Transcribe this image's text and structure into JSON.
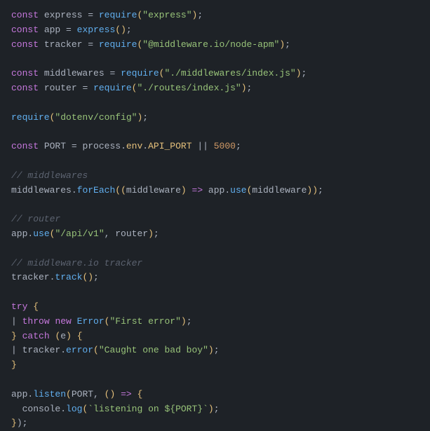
{
  "code": {
    "lines": [
      {
        "id": "l1",
        "tokens": [
          {
            "t": "kw",
            "v": "const"
          },
          {
            "t": "plain",
            "v": " express "
          },
          {
            "t": "op",
            "v": "="
          },
          {
            "t": "plain",
            "v": " "
          },
          {
            "t": "fn",
            "v": "require"
          },
          {
            "t": "paren",
            "v": "("
          },
          {
            "t": "str",
            "v": "\"express\""
          },
          {
            "t": "paren",
            "v": ")"
          },
          {
            "t": "plain",
            "v": ";"
          }
        ]
      },
      {
        "id": "l2",
        "tokens": [
          {
            "t": "kw",
            "v": "const"
          },
          {
            "t": "plain",
            "v": " app "
          },
          {
            "t": "op",
            "v": "="
          },
          {
            "t": "plain",
            "v": " "
          },
          {
            "t": "fn",
            "v": "express"
          },
          {
            "t": "paren",
            "v": "()"
          },
          {
            "t": "plain",
            "v": ";"
          }
        ]
      },
      {
        "id": "l3",
        "tokens": [
          {
            "t": "kw",
            "v": "const"
          },
          {
            "t": "plain",
            "v": " tracker "
          },
          {
            "t": "op",
            "v": "="
          },
          {
            "t": "plain",
            "v": " "
          },
          {
            "t": "fn",
            "v": "require"
          },
          {
            "t": "paren",
            "v": "("
          },
          {
            "t": "str",
            "v": "\"@middleware.io/node-apm\""
          },
          {
            "t": "paren",
            "v": ")"
          },
          {
            "t": "plain",
            "v": ";"
          }
        ]
      },
      {
        "id": "l4",
        "empty": true
      },
      {
        "id": "l5",
        "tokens": [
          {
            "t": "kw",
            "v": "const"
          },
          {
            "t": "plain",
            "v": " middlewares "
          },
          {
            "t": "op",
            "v": "="
          },
          {
            "t": "plain",
            "v": " "
          },
          {
            "t": "fn",
            "v": "require"
          },
          {
            "t": "paren",
            "v": "("
          },
          {
            "t": "str",
            "v": "\"./middlewares/index.js\""
          },
          {
            "t": "paren",
            "v": ")"
          },
          {
            "t": "plain",
            "v": ";"
          }
        ]
      },
      {
        "id": "l6",
        "tokens": [
          {
            "t": "kw",
            "v": "const"
          },
          {
            "t": "plain",
            "v": " router "
          },
          {
            "t": "op",
            "v": "="
          },
          {
            "t": "plain",
            "v": " "
          },
          {
            "t": "fn",
            "v": "require"
          },
          {
            "t": "paren",
            "v": "("
          },
          {
            "t": "str",
            "v": "\"./routes/index.js\""
          },
          {
            "t": "paren",
            "v": ")"
          },
          {
            "t": "plain",
            "v": ";"
          }
        ]
      },
      {
        "id": "l7",
        "empty": true
      },
      {
        "id": "l8",
        "tokens": [
          {
            "t": "fn",
            "v": "require"
          },
          {
            "t": "paren",
            "v": "("
          },
          {
            "t": "str",
            "v": "\"dotenv/config\""
          },
          {
            "t": "paren",
            "v": ")"
          },
          {
            "t": "plain",
            "v": ";"
          }
        ]
      },
      {
        "id": "l9",
        "empty": true
      },
      {
        "id": "l10",
        "tokens": [
          {
            "t": "kw",
            "v": "const"
          },
          {
            "t": "plain",
            "v": " PORT "
          },
          {
            "t": "op",
            "v": "="
          },
          {
            "t": "plain",
            "v": " process"
          },
          {
            "t": "plain",
            "v": "."
          },
          {
            "t": "prop",
            "v": "env"
          },
          {
            "t": "plain",
            "v": "."
          },
          {
            "t": "prop",
            "v": "API_PORT"
          },
          {
            "t": "plain",
            "v": " "
          },
          {
            "t": "op",
            "v": "||"
          },
          {
            "t": "plain",
            "v": " "
          },
          {
            "t": "num",
            "v": "5000"
          },
          {
            "t": "plain",
            "v": ";"
          }
        ]
      },
      {
        "id": "l11",
        "empty": true
      },
      {
        "id": "l12",
        "tokens": [
          {
            "t": "cm",
            "v": "// middlewares"
          }
        ]
      },
      {
        "id": "l13",
        "tokens": [
          {
            "t": "plain",
            "v": "middlewares"
          },
          {
            "t": "plain",
            "v": "."
          },
          {
            "t": "fn",
            "v": "forEach"
          },
          {
            "t": "paren",
            "v": "("
          },
          {
            "t": "paren",
            "v": "("
          },
          {
            "t": "plain",
            "v": "middleware"
          },
          {
            "t": "paren",
            "v": ")"
          },
          {
            "t": "plain",
            "v": " "
          },
          {
            "t": "arrow",
            "v": "=>"
          },
          {
            "t": "plain",
            "v": " app"
          },
          {
            "t": "plain",
            "v": "."
          },
          {
            "t": "fn",
            "v": "use"
          },
          {
            "t": "paren",
            "v": "("
          },
          {
            "t": "plain",
            "v": "middleware"
          },
          {
            "t": "paren",
            "v": "))"
          },
          {
            "t": "plain",
            "v": ";"
          }
        ]
      },
      {
        "id": "l14",
        "empty": true
      },
      {
        "id": "l15",
        "tokens": [
          {
            "t": "cm",
            "v": "// router"
          }
        ]
      },
      {
        "id": "l16",
        "tokens": [
          {
            "t": "plain",
            "v": "app"
          },
          {
            "t": "plain",
            "v": "."
          },
          {
            "t": "fn",
            "v": "use"
          },
          {
            "t": "paren",
            "v": "("
          },
          {
            "t": "str",
            "v": "\"/api/v1\""
          },
          {
            "t": "plain",
            "v": ", router"
          },
          {
            "t": "paren",
            "v": ")"
          },
          {
            "t": "plain",
            "v": ";"
          }
        ]
      },
      {
        "id": "l17",
        "empty": true
      },
      {
        "id": "l18",
        "tokens": [
          {
            "t": "cm",
            "v": "// middleware.io tracker"
          }
        ]
      },
      {
        "id": "l19",
        "tokens": [
          {
            "t": "plain",
            "v": "tracker"
          },
          {
            "t": "plain",
            "v": "."
          },
          {
            "t": "fn",
            "v": "track"
          },
          {
            "t": "paren",
            "v": "()"
          },
          {
            "t": "plain",
            "v": ";"
          }
        ]
      },
      {
        "id": "l20",
        "empty": true
      },
      {
        "id": "l21",
        "tokens": [
          {
            "t": "kw",
            "v": "try"
          },
          {
            "t": "plain",
            "v": " "
          },
          {
            "t": "paren",
            "v": "{"
          }
        ]
      },
      {
        "id": "l22",
        "tokens": [
          {
            "t": "plain",
            "v": "| "
          },
          {
            "t": "kw",
            "v": "throw"
          },
          {
            "t": "plain",
            "v": " "
          },
          {
            "t": "kw",
            "v": "new"
          },
          {
            "t": "plain",
            "v": " "
          },
          {
            "t": "fn",
            "v": "Error"
          },
          {
            "t": "paren",
            "v": "("
          },
          {
            "t": "str",
            "v": "\"First error\""
          },
          {
            "t": "paren",
            "v": ")"
          },
          {
            "t": "plain",
            "v": ";"
          }
        ]
      },
      {
        "id": "l23",
        "tokens": [
          {
            "t": "paren",
            "v": "}"
          },
          {
            "t": "plain",
            "v": " "
          },
          {
            "t": "kw",
            "v": "catch"
          },
          {
            "t": "plain",
            "v": " "
          },
          {
            "t": "paren",
            "v": "("
          },
          {
            "t": "plain",
            "v": "e"
          },
          {
            "t": "paren",
            "v": ")"
          },
          {
            "t": "plain",
            "v": " "
          },
          {
            "t": "paren",
            "v": "{"
          }
        ]
      },
      {
        "id": "l24",
        "tokens": [
          {
            "t": "plain",
            "v": "| "
          },
          {
            "t": "plain",
            "v": "tracker"
          },
          {
            "t": "plain",
            "v": "."
          },
          {
            "t": "fn",
            "v": "error"
          },
          {
            "t": "paren",
            "v": "("
          },
          {
            "t": "str",
            "v": "\"Caught one bad boy\""
          },
          {
            "t": "paren",
            "v": ")"
          },
          {
            "t": "plain",
            "v": ";"
          }
        ]
      },
      {
        "id": "l25",
        "tokens": [
          {
            "t": "paren",
            "v": "}"
          }
        ]
      },
      {
        "id": "l26",
        "empty": true
      },
      {
        "id": "l27",
        "tokens": [
          {
            "t": "plain",
            "v": "app"
          },
          {
            "t": "plain",
            "v": "."
          },
          {
            "t": "fn",
            "v": "listen"
          },
          {
            "t": "paren",
            "v": "("
          },
          {
            "t": "plain",
            "v": "PORT, "
          },
          {
            "t": "paren",
            "v": "("
          },
          {
            "t": "paren",
            "v": ")"
          },
          {
            "t": "plain",
            "v": " "
          },
          {
            "t": "arrow",
            "v": "=>"
          },
          {
            "t": "plain",
            "v": " "
          },
          {
            "t": "paren",
            "v": "{"
          }
        ]
      },
      {
        "id": "l28",
        "tokens": [
          {
            "t": "plain",
            "v": "  console"
          },
          {
            "t": "plain",
            "v": "."
          },
          {
            "t": "fn",
            "v": "log"
          },
          {
            "t": "paren",
            "v": "("
          },
          {
            "t": "tpl",
            "v": "`listening on ${PORT}`"
          },
          {
            "t": "paren",
            "v": ")"
          },
          {
            "t": "plain",
            "v": ";"
          }
        ]
      },
      {
        "id": "l29",
        "tokens": [
          {
            "t": "paren",
            "v": "}"
          },
          {
            "t": "plain",
            "v": ")"
          },
          {
            "t": "plain",
            "v": ";"
          }
        ]
      }
    ]
  }
}
